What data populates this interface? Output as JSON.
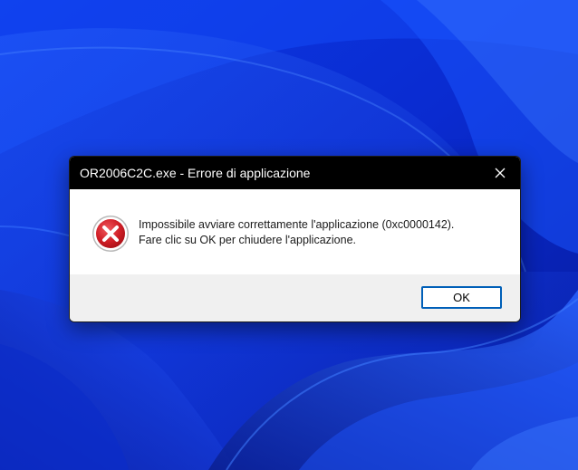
{
  "dialog": {
    "title": "OR2006C2C.exe - Errore di applicazione",
    "close_icon": "close-icon",
    "error_icon": "error-icon",
    "message_line1": "Impossibile avviare correttamente l'applicazione (0xc0000142).",
    "message_line2": "Fare clic su OK per chiudere l'applicazione.",
    "ok_label": "OK"
  },
  "colors": {
    "titlebar": "#000000",
    "footer": "#f0f0f0",
    "ok_focus_border": "#005fb8",
    "error_red": "#d11f27",
    "wallpaper_blue": "#0a2fd8"
  }
}
